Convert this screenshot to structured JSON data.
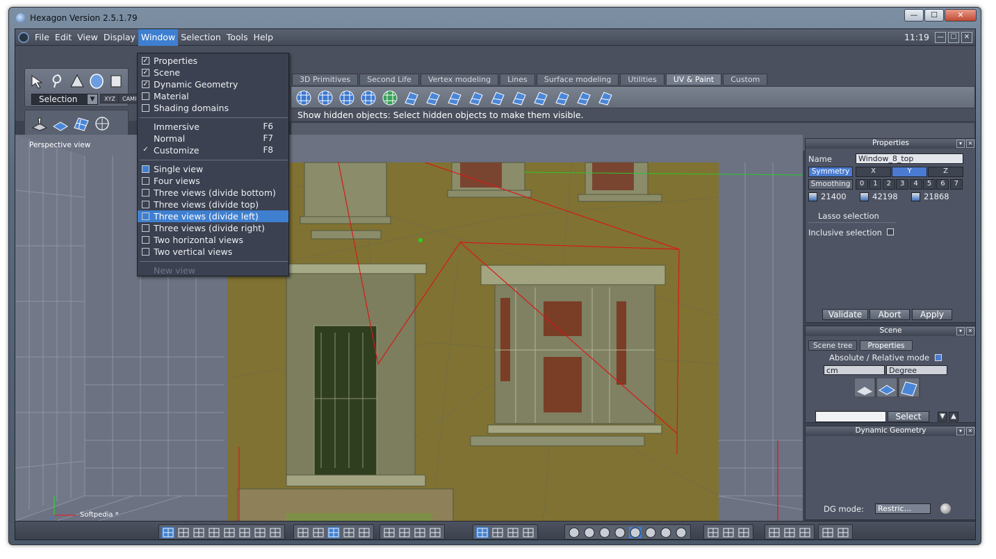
{
  "window": {
    "title": "Hexagon Version 2.5.1.79",
    "minimize": "—",
    "maximize": "☐",
    "close": "✕"
  },
  "menubar": {
    "items": [
      "File",
      "Edit",
      "View",
      "Display",
      "Window",
      "Selection",
      "Tools",
      "Help"
    ],
    "active": "Window",
    "clock": "11:19",
    "mdi_min": "—",
    "mdi_max": "☐",
    "mdi_close": "✕"
  },
  "toolbar": {
    "selection_combo": "Selection",
    "chips": [
      "XYZ",
      "CAMI"
    ],
    "tabs": [
      "3D Primitives",
      "Second Life",
      "Vertex modeling",
      "Lines",
      "Surface modeling",
      "Utilities",
      "UV & Paint",
      "Custom"
    ],
    "active_tab": "UV & Paint",
    "hint": "Show hidden objects: Select hidden objects to make them visible."
  },
  "window_menu": {
    "panels": [
      {
        "label": "Properties",
        "checked": true
      },
      {
        "label": "Scene",
        "checked": true
      },
      {
        "label": "Dynamic Geometry",
        "checked": true
      },
      {
        "label": "Material",
        "checked": false
      },
      {
        "label": "Shading domains",
        "checked": false
      }
    ],
    "modes": [
      {
        "label": "Immersive",
        "shortcut": "F6",
        "checked": false
      },
      {
        "label": "Normal",
        "shortcut": "F7",
        "checked": false
      },
      {
        "label": "Customize",
        "shortcut": "F8",
        "checked": true
      }
    ],
    "views": [
      {
        "label": "Single view",
        "highlighted": false
      },
      {
        "label": "Four views",
        "highlighted": false
      },
      {
        "label": "Three views (divide bottom)",
        "highlighted": false
      },
      {
        "label": "Three views (divide top)",
        "highlighted": false
      },
      {
        "label": "Three views (divide left)",
        "highlighted": true
      },
      {
        "label": "Three views (divide right)",
        "highlighted": false
      },
      {
        "label": "Two horizontal views",
        "highlighted": false
      },
      {
        "label": "Two vertical views",
        "highlighted": false
      }
    ],
    "new_view": "New view"
  },
  "viewport": {
    "label": "Perspective view",
    "axis_label": "Softpedia *",
    "watermark": "SOFTPEDIA"
  },
  "properties_panel": {
    "title": "Properties",
    "name_label": "Name",
    "name_value": "Window_8_top",
    "symmetry_label": "Symmetry",
    "symmetry_axes": [
      "X",
      "Y",
      "Z"
    ],
    "symmetry_active": "Y",
    "smoothing_label": "Smoothing",
    "smoothing_levels": [
      "0",
      "1",
      "2",
      "3",
      "4",
      "5",
      "6",
      "7"
    ],
    "counts": [
      "21400",
      "42198",
      "21868"
    ],
    "lasso": "Lasso selection",
    "inclusive": "Inclusive selection",
    "validate": "Validate",
    "abort": "Abort",
    "apply": "Apply"
  },
  "scene_panel": {
    "title": "Scene",
    "tabs": [
      "Scene tree",
      "Properties"
    ],
    "active_tab": "Properties",
    "abs_rel": "Absolute / Relative mode",
    "unit": "cm",
    "angle": "Degree",
    "select_button": "Select"
  },
  "dg_panel": {
    "title": "Dynamic Geometry",
    "mode_label": "DG mode:",
    "mode_value": "Restric..."
  },
  "colors": {
    "accent": "#3f7fd0",
    "wall": "#807232",
    "wireframe_red": "#d81818",
    "menu_bg": "#3b4150"
  }
}
